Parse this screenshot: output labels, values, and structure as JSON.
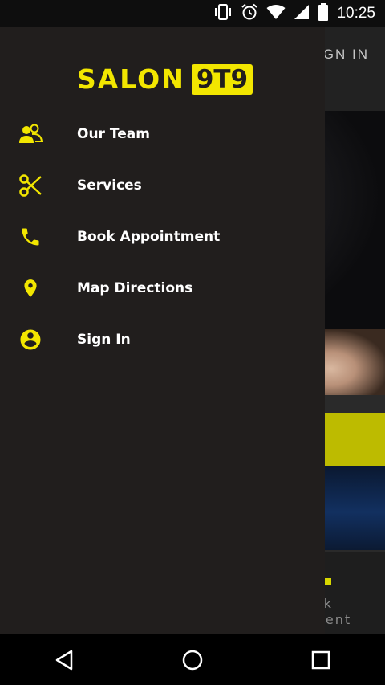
{
  "status_bar": {
    "time": "10:25"
  },
  "background_app": {
    "signin_partial": "GN IN",
    "book_partial_line1": "ok",
    "book_partial_line2": "tment"
  },
  "drawer": {
    "logo_text": "SALON",
    "logo_badge": "9T9",
    "items": [
      {
        "label": "Our Team",
        "icon": "team-icon"
      },
      {
        "label": "Services",
        "icon": "scissors-icon"
      },
      {
        "label": "Book Appointment",
        "icon": "phone-icon"
      },
      {
        "label": "Map Directions",
        "icon": "location-pin-icon"
      },
      {
        "label": "Sign In",
        "icon": "account-circle-icon"
      }
    ]
  },
  "colors": {
    "accent": "#f2e600",
    "drawer_bg": "#211e1d"
  }
}
